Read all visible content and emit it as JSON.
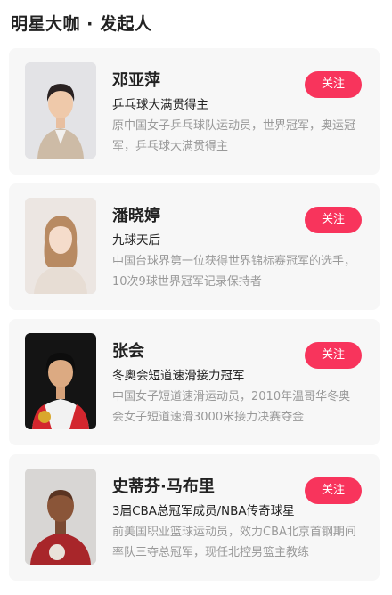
{
  "section": {
    "title": "明星大咖 · 发起人"
  },
  "colors": {
    "accent": "#f8345c",
    "card_bg": "#f7f7f7",
    "desc_text": "#999999"
  },
  "cards": [
    {
      "name": "邓亚萍",
      "subtitle": "乒乓球大满贯得主",
      "desc": "原中国女子乒乓球队运动员，世界冠军，奥运冠军，乒乓球大满贯得主",
      "follow_label": "关注"
    },
    {
      "name": "潘晓婷",
      "subtitle": "九球天后",
      "desc": "中国台球界第一位获得世界锦标赛冠军的选手，10次9球世界冠军记录保持者",
      "follow_label": "关注"
    },
    {
      "name": "张会",
      "subtitle": "冬奥会短道速滑接力冠军",
      "desc": "中国女子短道速滑运动员，2010年温哥华冬奥会女子短道速滑3000米接力决赛夺金",
      "follow_label": "关注"
    },
    {
      "name": "史蒂芬·马布里",
      "subtitle": "3届CBA总冠军成员/NBA传奇球星",
      "desc": "前美国职业篮球运动员，效力CBA北京首钢期间率队三夺总冠军，现任北控男篮主教练",
      "follow_label": "关注"
    }
  ]
}
